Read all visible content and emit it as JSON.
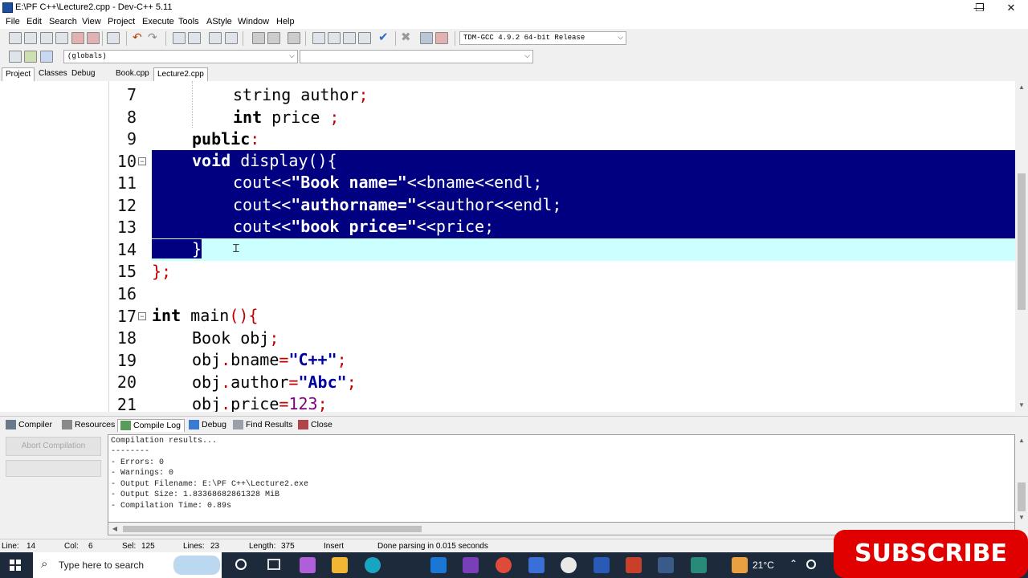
{
  "window": {
    "title": "E:\\PF C++\\Lecture2.cpp - Dev-C++ 5.11",
    "controls": [
      "—",
      "❐",
      "✕"
    ]
  },
  "menu": [
    "File",
    "Edit",
    "Search",
    "View",
    "Project",
    "Execute",
    "Tools",
    "AStyle",
    "Window",
    "Help"
  ],
  "toolbar": {
    "compiler_select": "TDM-GCC 4.9.2 64-bit Release",
    "scope_select": "(globals)",
    "member_select": ""
  },
  "left_tabs": [
    "Project",
    "Classes",
    "Debug"
  ],
  "editor_tabs": [
    "Book.cpp",
    "Lecture2.cpp"
  ],
  "code_lines": [
    {
      "n": "7"
    },
    {
      "n": "8"
    },
    {
      "n": "9"
    },
    {
      "n": "10"
    },
    {
      "n": "11"
    },
    {
      "n": "12"
    },
    {
      "n": "13"
    },
    {
      "n": "14"
    },
    {
      "n": "15"
    },
    {
      "n": "16"
    },
    {
      "n": "17"
    },
    {
      "n": "18"
    },
    {
      "n": "19"
    },
    {
      "n": "20"
    },
    {
      "n": "21"
    }
  ],
  "code": {
    "l7": {
      "a": "string author",
      "b": ";"
    },
    "l8": {
      "kw": "int",
      "a": " price ",
      "b": ";"
    },
    "l9": {
      "kw": "public",
      "b": ":"
    },
    "l10": {
      "kw": "void",
      "a": " display(){"
    },
    "l11": {
      "a": "cout<<",
      "s": "\"Book name=\"",
      "c": "<<bname<<endl;"
    },
    "l12": {
      "a": "cout<<",
      "s": "\"authorname=\"",
      "c": "<<author<<endl;"
    },
    "l13": {
      "a": "cout<<",
      "s": "\"book price=\"",
      "c": "<<price;"
    },
    "l14": {
      "a": "}"
    },
    "l15": {
      "b": "};"
    },
    "l17": {
      "kw": "int",
      "a": " main",
      "b": "(){"
    },
    "l18": {
      "a": "Book obj",
      "b": ";"
    },
    "l19": {
      "a": "obj",
      "p1": ".",
      "a2": "bname",
      "p2": "=",
      "s": "\"C++\"",
      "b": ";"
    },
    "l20": {
      "a": "obj",
      "p1": ".",
      "a2": "author",
      "p2": "=",
      "s": "\"Abc\"",
      "b": ";"
    },
    "l21": {
      "a": "obj",
      "p1": ".",
      "a2": "price",
      "p2": "=",
      "num": "123",
      "b": ";"
    }
  },
  "bottom_tabs": [
    "Compiler",
    "Resources",
    "Compile Log",
    "Debug",
    "Find Results",
    "Close"
  ],
  "abort_button": "Abort Compilation",
  "log": [
    "Compilation results...",
    "--------",
    "- Errors: 0",
    "- Warnings: 0",
    "- Output Filename: E:\\PF C++\\Lecture2.exe",
    "- Output Size: 1.83368682861328 MiB",
    "- Compilation Time: 0.89s"
  ],
  "status": {
    "line_label": "Line:",
    "line": "14",
    "col_label": "Col:",
    "col": "6",
    "sel_label": "Sel:",
    "sel": "125",
    "lines_label": "Lines:",
    "lines": "23",
    "length_label": "Length:",
    "length": "375",
    "mode": "Insert",
    "message": "Done parsing in 0.015 seconds"
  },
  "taskbar": {
    "search_placeholder": "Type here to search",
    "weather": "21°C"
  },
  "overlay": {
    "subscribe": "SUBSCRIBE"
  },
  "colors": {
    "selection": "#000080",
    "current_line": "#ccffff",
    "keyword_punct": "#c00000",
    "subscribe": "#e00000"
  }
}
